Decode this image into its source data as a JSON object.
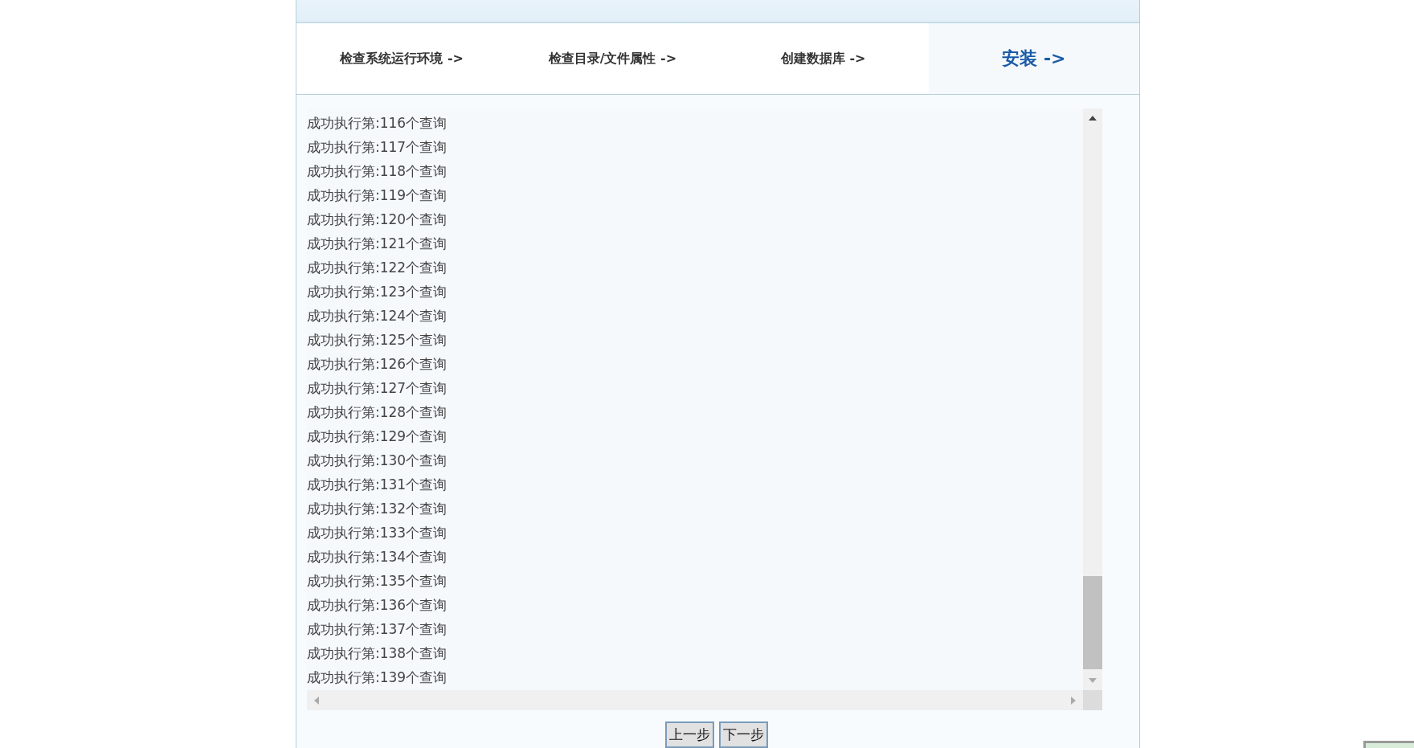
{
  "steps": [
    {
      "label": "检查系统运行环境 ->",
      "selected": false
    },
    {
      "label": "检查目录/文件属性 ->",
      "selected": false
    },
    {
      "label": "创建数据库 ->",
      "selected": false
    },
    {
      "label": "安装 ->",
      "selected": true
    }
  ],
  "log": {
    "lines": [
      "成功执行第:116个查询",
      "成功执行第:117个查询",
      "成功执行第:118个查询",
      "成功执行第:119个查询",
      "成功执行第:120个查询",
      "成功执行第:121个查询",
      "成功执行第:122个查询",
      "成功执行第:123个查询",
      "成功执行第:124个查询",
      "成功执行第:125个查询",
      "成功执行第:126个查询",
      "成功执行第:127个查询",
      "成功执行第:128个查询",
      "成功执行第:129个查询",
      "成功执行第:130个查询",
      "成功执行第:131个查询",
      "成功执行第:132个查询",
      "成功执行第:133个查询",
      "成功执行第:134个查询",
      "成功执行第:135个查询",
      "成功执行第:136个查询",
      "成功执行第:137个查询",
      "成功执行第:138个查询",
      "成功执行第:139个查询"
    ]
  },
  "buttons": [
    "上一步",
    "下一步"
  ]
}
